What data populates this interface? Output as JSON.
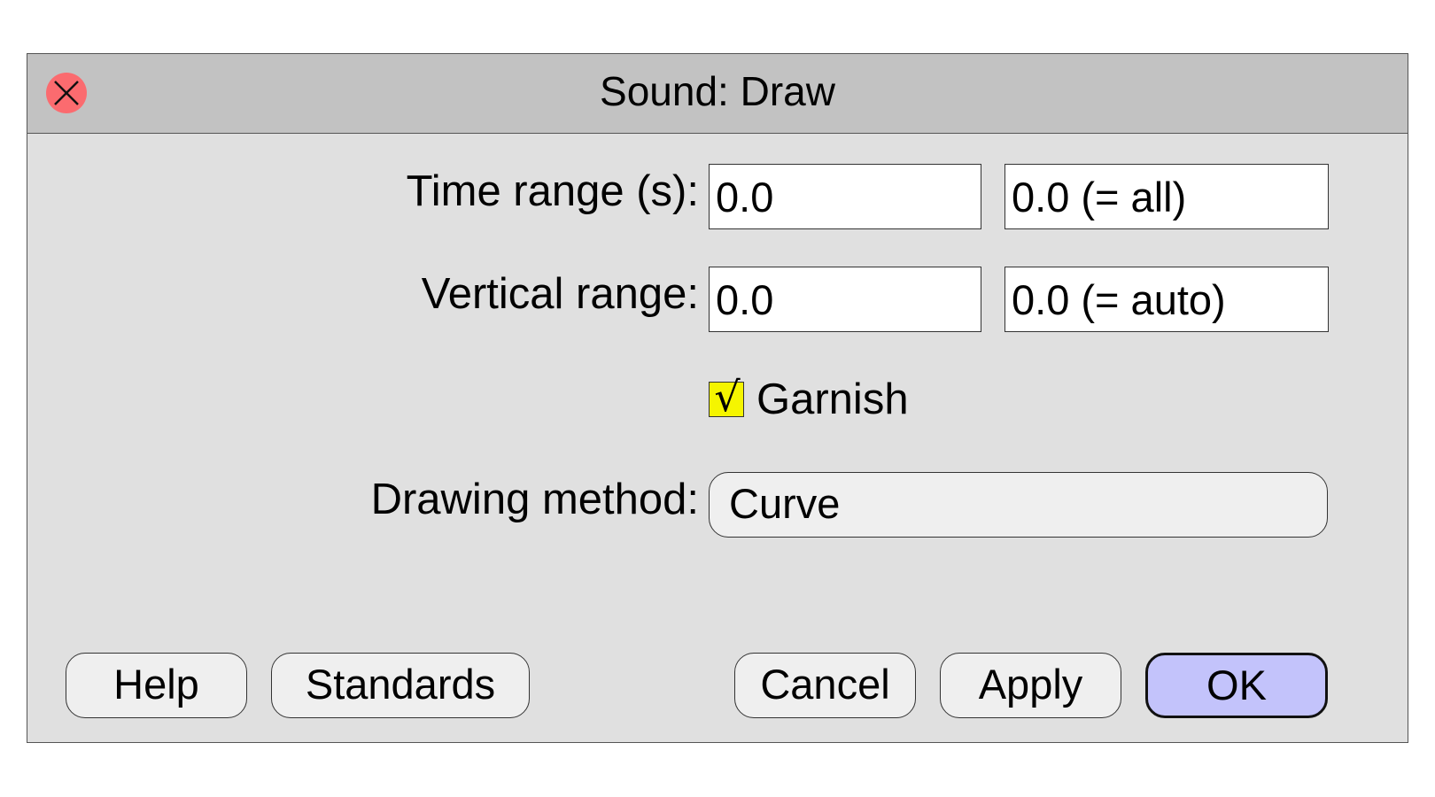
{
  "window": {
    "title": "Sound: Draw",
    "close_icon": "close-icon"
  },
  "form": {
    "time_range": {
      "label": "Time range (s):",
      "from_value": "0.0",
      "to_value": "0.0 (= all)"
    },
    "vertical_range": {
      "label": "Vertical range:",
      "from_value": "0.0",
      "to_value": "0.0 (= auto)"
    },
    "garnish": {
      "label": "Garnish",
      "checked": true,
      "check_glyph": "√"
    },
    "drawing_method": {
      "label": "Drawing method:",
      "selected": "Curve"
    }
  },
  "buttons": {
    "help": "Help",
    "standards": "Standards",
    "cancel": "Cancel",
    "apply": "Apply",
    "ok": "OK"
  },
  "colors": {
    "titlebar": "#c2c2c2",
    "dialog_bg": "#e0e0e0",
    "close_button": "#fb6b6f",
    "checkbox_fill": "#f5f500",
    "default_button": "#c3c3fb"
  }
}
